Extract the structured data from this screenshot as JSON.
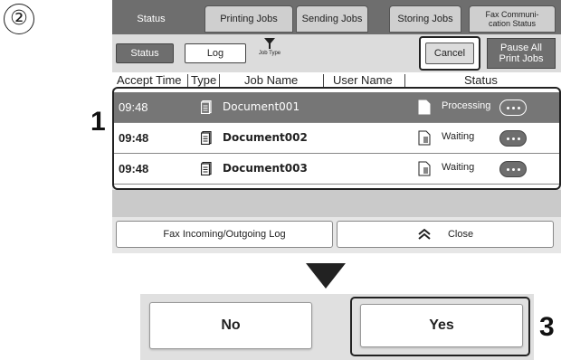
{
  "step_marker": "②",
  "callouts": {
    "c1": "1",
    "c2": "2",
    "c3": "3"
  },
  "tabs": [
    {
      "label": "Status",
      "active": true
    },
    {
      "label": "Printing Jobs",
      "active": false
    },
    {
      "label": "Sending Jobs",
      "active": false
    },
    {
      "label": "Storing Jobs",
      "active": false
    },
    {
      "label": "Fax Communi-\ncation Status",
      "active": false
    }
  ],
  "subbar": {
    "status_label": "Status",
    "log_label": "Log",
    "job_type_label": "Job Type",
    "job_type_icon": "filter-icon",
    "cancel_label": "Cancel",
    "pause_label": "Pause All\nPrint Jobs"
  },
  "columns": [
    "Accept Time",
    "Type",
    "Job Name",
    "User Name",
    "Status"
  ],
  "jobs": [
    {
      "time": "09:48",
      "name": "Document001",
      "status": "Processing",
      "selected": true
    },
    {
      "time": "09:48",
      "name": "Document002",
      "status": "Waiting",
      "selected": false
    },
    {
      "time": "09:48",
      "name": "Document003",
      "status": "Waiting",
      "selected": false
    }
  ],
  "bottom": {
    "fax_log_label": "Fax Incoming/Outgoing Log",
    "close_label": "Close",
    "close_icon": "double-chevron-up-icon"
  },
  "dialog": {
    "no_label": "No",
    "yes_label": "Yes"
  },
  "colors": {
    "dark_gray": "#6e6e6e",
    "selected_row": "#767676",
    "panel_bg": "#e6e6e6"
  }
}
